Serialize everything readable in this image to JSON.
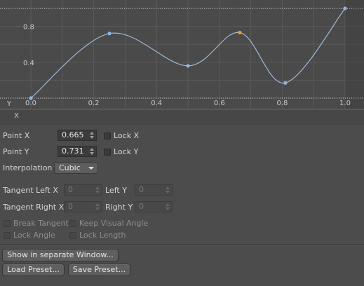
{
  "curve": {
    "y_axis_label": "Y",
    "x_axis_label": "X",
    "x_ticks": [
      "0.0",
      "0.2",
      "0.4",
      "0.6",
      "0.8",
      "1.0"
    ],
    "y_ticks": [
      "0.8",
      "0.4"
    ],
    "points": [
      {
        "x": 0.0,
        "y": 0.0
      },
      {
        "x": 0.25,
        "y": 0.72
      },
      {
        "x": 0.5,
        "y": 0.36
      },
      {
        "x": 0.665,
        "y": 0.731,
        "selected": true
      },
      {
        "x": 0.81,
        "y": 0.17
      },
      {
        "x": 1.0,
        "y": 1.0
      }
    ],
    "colors": {
      "curve": "#9fb8d4",
      "point": "#8fb6e0",
      "selected_point": "#f0a030",
      "grid": "#5a5a5a",
      "boundary": "#d0d0d0"
    }
  },
  "point_x": {
    "label": "Point X",
    "value": "0.665",
    "lock_label": "Lock X"
  },
  "point_y": {
    "label": "Point Y",
    "value": "0.731",
    "lock_label": "Lock Y"
  },
  "interpolation": {
    "label": "Interpolation",
    "value": "Cubic"
  },
  "tangent_left": {
    "label_x": "Tangent Left X",
    "value_x": "0",
    "label_y": "Left Y",
    "value_y": "0"
  },
  "tangent_right": {
    "label_x": "Tangent Right X",
    "value_x": "0",
    "label_y": "Right Y",
    "value_y": "0"
  },
  "options": {
    "break_tangent": "Break Tangent",
    "keep_visual_angle": "Keep Visual Angle",
    "lock_angle": "Lock Angle",
    "lock_length": "Lock Length"
  },
  "buttons": {
    "show_window": "Show in separate Window...",
    "load_preset": "Load Preset...",
    "save_preset": "Save Preset..."
  }
}
